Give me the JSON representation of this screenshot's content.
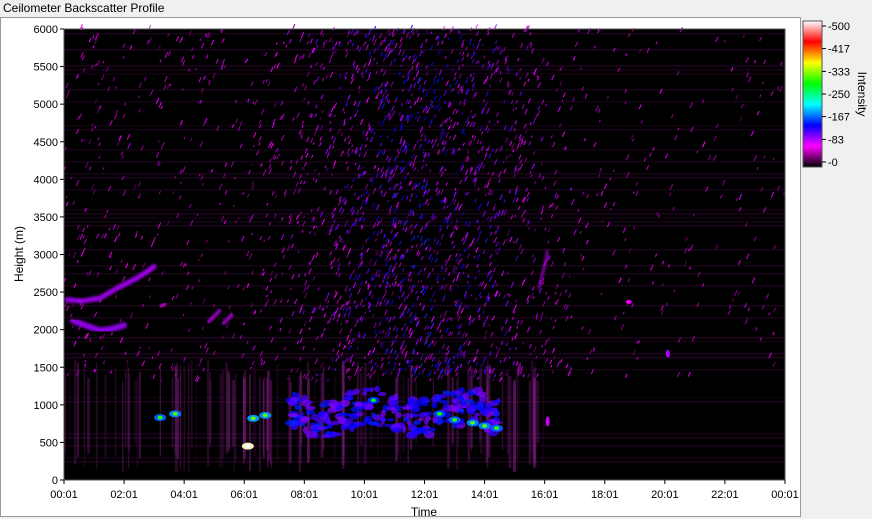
{
  "window": {
    "title": "Ceilometer Backscatter Profile"
  },
  "chart_data": {
    "type": "heatmap",
    "title": "Ceilometer Backscatter Profile",
    "xlabel": "Time",
    "ylabel": "Height (m)",
    "ylim": [
      0,
      6000
    ],
    "yticks": [
      0,
      500,
      1000,
      1500,
      2000,
      2500,
      3000,
      3500,
      4000,
      4500,
      5000,
      5500,
      6000
    ],
    "xticks": [
      "00:01",
      "02:01",
      "04:01",
      "06:01",
      "08:01",
      "10:01",
      "12:01",
      "14:01",
      "16:01",
      "18:01",
      "20:01",
      "22:01",
      "00:01"
    ],
    "colorbar": {
      "label": "Intensity",
      "range": [
        0,
        500
      ],
      "ticks": [
        0,
        83,
        167,
        250,
        333,
        417,
        500
      ],
      "colors": [
        "#000000",
        "#ff00ff",
        "#0000ff",
        "#00ffff",
        "#00ff00",
        "#ffff00",
        "#ff0000",
        "#ffffff"
      ]
    },
    "features": [
      {
        "desc": "diffuse noise region",
        "time_h": [
          8,
          16
        ],
        "height": [
          1500,
          6000
        ],
        "intensity": 90
      },
      {
        "desc": "aerosol layer",
        "time_h": [
          0,
          2.5
        ],
        "height": [
          1950,
          2150
        ],
        "intensity": 110
      },
      {
        "desc": "aerosol layer",
        "time_h": [
          0,
          3.2
        ],
        "height": [
          2350,
          2850
        ],
        "intensity": 110
      },
      {
        "desc": "cloud base",
        "time_h": [
          3,
          4
        ],
        "height": [
          800,
          900
        ],
        "intensity": 200
      },
      {
        "desc": "cloud base",
        "time_h": [
          6.2,
          7
        ],
        "height": [
          800,
          900
        ],
        "intensity": 200
      },
      {
        "desc": "cloud base",
        "time_h": [
          6.05,
          6.2
        ],
        "height": [
          450,
          450
        ],
        "intensity": 480
      },
      {
        "desc": "cloud base",
        "time_h": [
          7.5,
          14.5
        ],
        "height": [
          650,
          1150
        ],
        "intensity": 150
      },
      {
        "desc": "cloud base",
        "time_h": [
          20,
          20.1
        ],
        "height": [
          1650,
          1700
        ],
        "intensity": 100
      }
    ]
  }
}
